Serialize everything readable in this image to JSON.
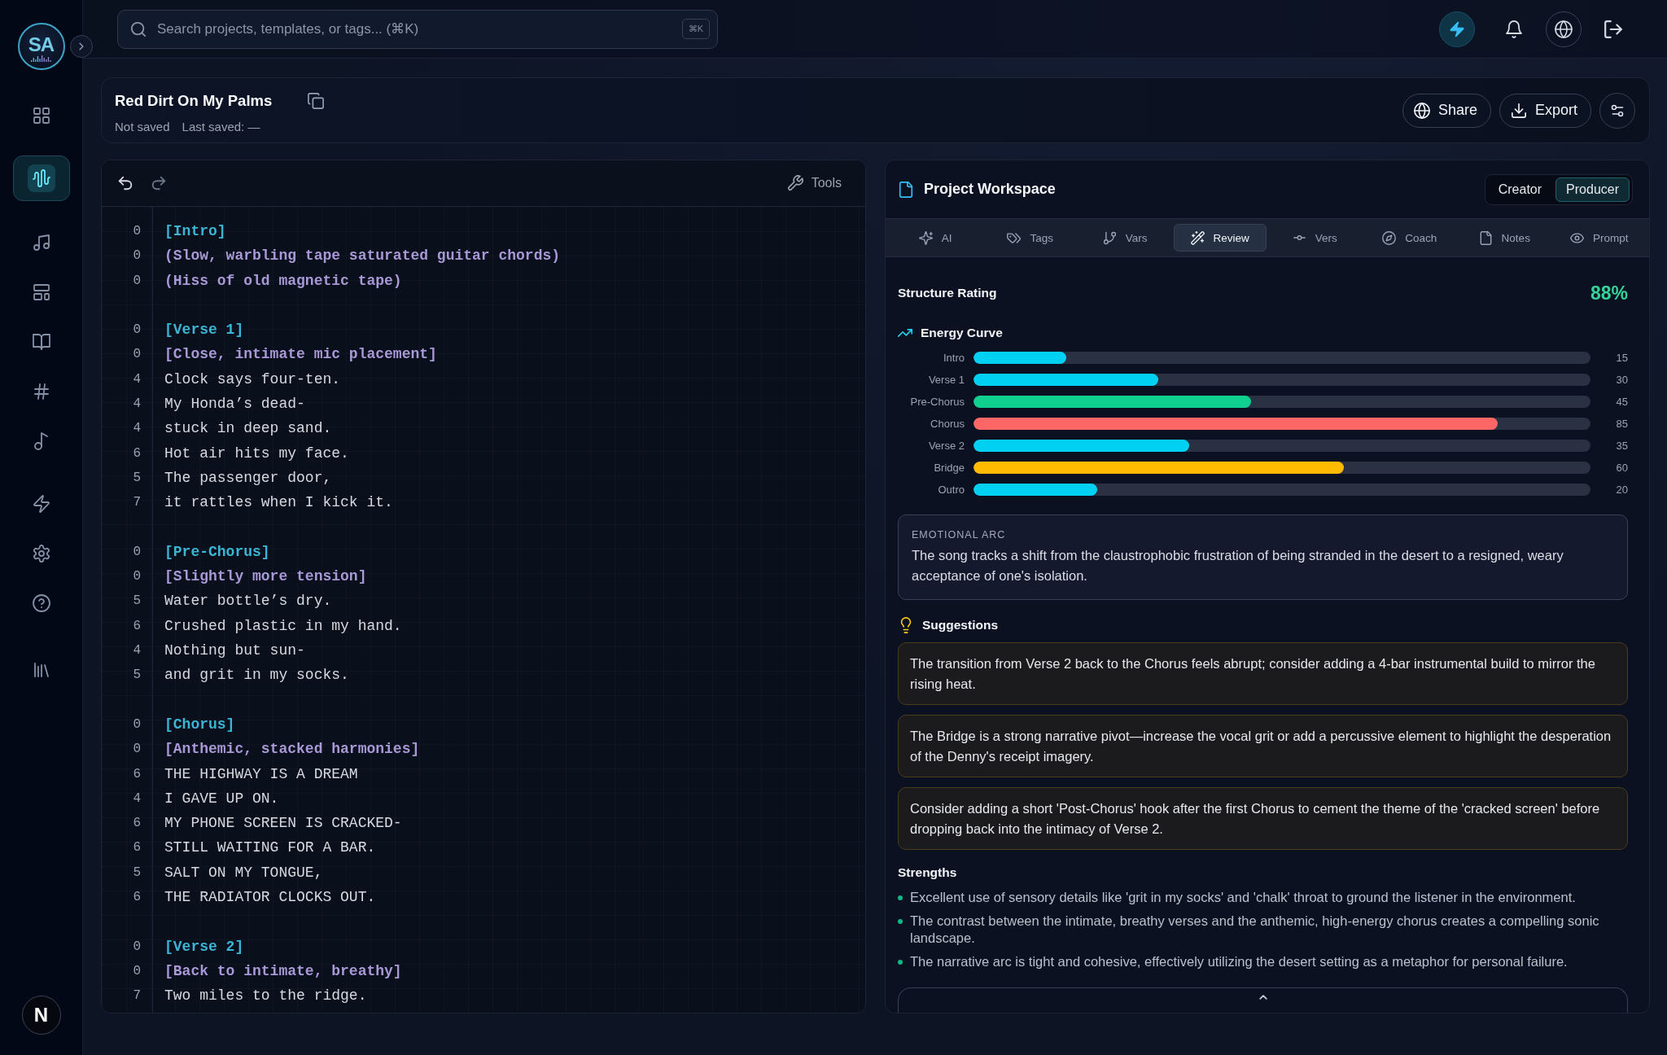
{
  "sidebar": {
    "logo": "SA",
    "items": [
      {
        "selected": false
      },
      {
        "selected": true
      },
      {
        "selected": false
      },
      {
        "selected": false
      },
      {
        "selected": false
      },
      {
        "selected": false
      },
      {
        "selected": false
      },
      {
        "selected": false
      },
      {
        "selected": false
      },
      {
        "selected": false
      },
      {
        "selected": false
      }
    ],
    "avatar": "N"
  },
  "topbar": {
    "search": {
      "placeholder": "Search projects, templates, or tags... (⌘K)",
      "shortcut": "⌘K"
    }
  },
  "project": {
    "title": "Red Dirt On My Palms",
    "status": "Not saved",
    "last_saved": "Last saved: —",
    "actions": [
      {
        "kind": "share",
        "label": "Share"
      },
      {
        "kind": "export",
        "label": "Export"
      }
    ]
  },
  "editor": {
    "tools_label": "Tools",
    "lines": [
      {
        "kind": "section",
        "text": "[Intro]",
        "count": "0"
      },
      {
        "kind": "direction",
        "text": "(Slow, warbling tape saturated guitar chords)",
        "count": "0"
      },
      {
        "kind": "direction",
        "text": "(Hiss of old magnetic tape)",
        "count": "0"
      },
      {
        "kind": "blank"
      },
      {
        "kind": "section",
        "text": "[Verse 1]",
        "count": "0"
      },
      {
        "kind": "direction",
        "text": "[Close, intimate mic placement]",
        "count": "0"
      },
      {
        "kind": "lyric",
        "text": "Clock says four-ten.",
        "count": "4"
      },
      {
        "kind": "lyric",
        "text": "My Honda’s dead-",
        "count": "4"
      },
      {
        "kind": "lyric",
        "text": "stuck in deep sand.",
        "count": "4"
      },
      {
        "kind": "lyric",
        "text": "Hot air hits my face.",
        "count": "6"
      },
      {
        "kind": "lyric",
        "text": "The passenger door,",
        "count": "5"
      },
      {
        "kind": "lyric",
        "text": "it rattles when I kick it.",
        "count": "7"
      },
      {
        "kind": "blank"
      },
      {
        "kind": "section",
        "text": "[Pre-Chorus]",
        "count": "0"
      },
      {
        "kind": "direction",
        "text": "[Slightly more tension]",
        "count": "0"
      },
      {
        "kind": "lyric",
        "text": "Water bottle’s dry.",
        "count": "5"
      },
      {
        "kind": "lyric",
        "text": "Crushed plastic in my hand.",
        "count": "6"
      },
      {
        "kind": "lyric",
        "text": "Nothing but sun-",
        "count": "4"
      },
      {
        "kind": "lyric",
        "text": "and grit in my socks.",
        "count": "5"
      },
      {
        "kind": "blank"
      },
      {
        "kind": "section",
        "text": "[Chorus]",
        "count": "0"
      },
      {
        "kind": "direction",
        "text": "[Anthemic, stacked harmonies]",
        "count": "0"
      },
      {
        "kind": "lyric",
        "text": "THE HIGHWAY IS A DREAM",
        "count": "6"
      },
      {
        "kind": "lyric",
        "text": "I GAVE UP ON.",
        "count": "4"
      },
      {
        "kind": "lyric",
        "text": "MY PHONE SCREEN IS CRACKED-",
        "count": "6"
      },
      {
        "kind": "lyric",
        "text": "STILL WAITING FOR A BAR.",
        "count": "6"
      },
      {
        "kind": "lyric",
        "text": "SALT ON MY TONGUE,",
        "count": "5"
      },
      {
        "kind": "lyric",
        "text": "THE RADIATOR CLOCKS OUT.",
        "count": "6"
      },
      {
        "kind": "blank"
      },
      {
        "kind": "section",
        "text": "[Verse 2]",
        "count": "0"
      },
      {
        "kind": "direction",
        "text": "[Back to intimate, breathy]",
        "count": "0"
      },
      {
        "kind": "lyric",
        "text": "Two miles to the ridge.",
        "count": "7"
      }
    ]
  },
  "workspace": {
    "title": "Project Workspace",
    "modes": [
      {
        "label": "Creator",
        "selected": false
      },
      {
        "label": "Producer",
        "selected": true
      }
    ],
    "tabs": [
      {
        "label": "AI",
        "selected": false
      },
      {
        "label": "Tags",
        "selected": false
      },
      {
        "label": "Vars",
        "selected": false
      },
      {
        "label": "Review",
        "selected": true
      },
      {
        "label": "Vers",
        "selected": false
      },
      {
        "label": "Coach",
        "selected": false
      },
      {
        "label": "Notes",
        "selected": false
      },
      {
        "label": "Prompt",
        "selected": false
      }
    ],
    "review": {
      "structure_rating": {
        "label": "Structure Rating",
        "value": "88%"
      },
      "energy_curve": {
        "title": "Energy Curve",
        "sections": [
          {
            "label": "Intro",
            "level": 0.15,
            "reading": "15",
            "color": "#00d1f2"
          },
          {
            "label": "Verse 1",
            "level": 0.3,
            "reading": "30",
            "color": "#00d1f2"
          },
          {
            "label": "Pre-Chorus",
            "level": 0.45,
            "reading": "45",
            "color": "#10d08f"
          },
          {
            "label": "Chorus",
            "level": 0.85,
            "reading": "85",
            "color": "#ff6666"
          },
          {
            "label": "Verse 2",
            "level": 0.35,
            "reading": "35",
            "color": "#00d1f2"
          },
          {
            "label": "Bridge",
            "level": 0.6,
            "reading": "60",
            "color": "#ffbb00"
          },
          {
            "label": "Outro",
            "level": 0.2,
            "reading": "20",
            "color": "#00d1f2"
          }
        ]
      },
      "emotional_arc": {
        "label": "EMOTIONAL ARC",
        "text": "The song tracks a shift from the claustrophobic frustration of being stranded in the desert to a resigned, weary acceptance of one's isolation."
      },
      "suggestions": {
        "title": "Suggestions",
        "items": [
          "The transition from Verse 2 back to the Chorus feels abrupt; consider adding a 4-bar instrumental build to mirror the rising heat.",
          "The Bridge is a strong narrative pivot—increase the vocal grit or add a percussive element to highlight the desperation of the Denny's receipt imagery.",
          "Consider adding a short 'Post-Chorus' hook after the first Chorus to cement the theme of the 'cracked screen' before dropping back into the intimacy of Verse 2."
        ]
      },
      "strengths": {
        "title": "Strengths",
        "items": [
          "Excellent use of sensory details like 'grit in my socks' and 'chalk' throat to ground the listener in the environment.",
          "The contrast between the intimate, breathy verses and the anthemic, high-energy chorus creates a compelling sonic landscape.",
          "The narrative arc is tight and cohesive, effectively utilizing the desert setting as a metaphor for personal failure."
        ]
      }
    }
  }
}
